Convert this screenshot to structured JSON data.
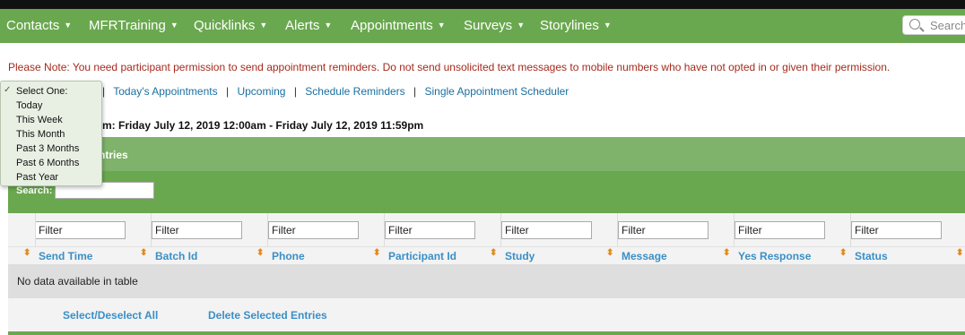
{
  "nav": {
    "items": [
      {
        "label": "Contacts"
      },
      {
        "label": "MFRTraining"
      },
      {
        "label": "Quicklinks"
      },
      {
        "label": "Alerts"
      },
      {
        "label": "Appointments"
      },
      {
        "label": "Surveys"
      },
      {
        "label": "Storylines"
      }
    ],
    "search_placeholder": "Search"
  },
  "notice": "Please Note: You need participant permission to send appointment reminders. Do not send unsolicited text messages to mobile numbers who have not opted in or given their permission.",
  "links": [
    "Today's Appointments",
    "Upcoming",
    "Schedule Reminders",
    "Single Appointment Scheduler"
  ],
  "link_separator": "|",
  "range_text": "m: Friday July 12, 2019 12:00am - Friday July 12, 2019 11:59pm",
  "panel": {
    "title": "ntries",
    "search_label": "Search:",
    "filter_placeholder": "Filter",
    "columns": [
      "Send Time",
      "Batch Id",
      "Phone",
      "Participant Id",
      "Study",
      "Message",
      "Yes Response",
      "Status"
    ],
    "empty_text": "No data available in table",
    "select_all": "Select/Deselect All",
    "delete_selected": "Delete Selected Entries"
  },
  "dropdown": {
    "options": [
      "Select One:",
      "Today",
      "This Week",
      "This Month",
      "Past 3 Months",
      "Past 6 Months",
      "Past Year"
    ],
    "selected_index": 0,
    "check_mark": "✓"
  },
  "colors": {
    "nav_green": "#6aa84f",
    "notice_red": "#a52a1c",
    "link_blue": "#1a6f9f",
    "header_blue": "#3a8fc6",
    "sort_orange": "#e08a1e"
  }
}
